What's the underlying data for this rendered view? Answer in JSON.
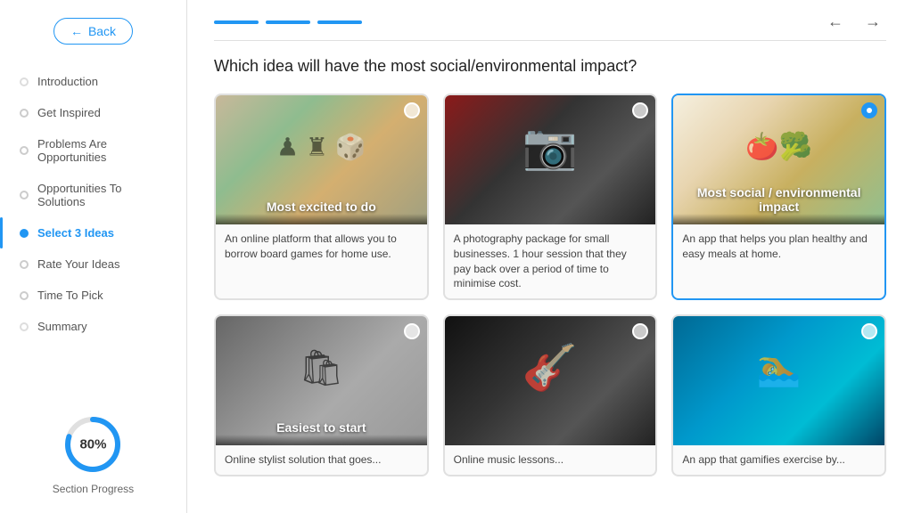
{
  "sidebar": {
    "back_label": "Back",
    "nav_items": [
      {
        "id": "introduction",
        "label": "Introduction",
        "active": false,
        "dot": "dim"
      },
      {
        "id": "get-inspired",
        "label": "Get Inspired",
        "active": false,
        "dot": "normal"
      },
      {
        "id": "problems",
        "label": "Problems Are Opportunities",
        "active": false,
        "dot": "normal"
      },
      {
        "id": "opportunities",
        "label": "Opportunities To Solutions",
        "active": false,
        "dot": "normal"
      },
      {
        "id": "select-ideas",
        "label": "Select 3 Ideas",
        "active": true,
        "dot": "active"
      },
      {
        "id": "rate-ideas",
        "label": "Rate Your Ideas",
        "active": false,
        "dot": "normal"
      },
      {
        "id": "time-to-pick",
        "label": "Time To Pick",
        "active": false,
        "dot": "normal"
      },
      {
        "id": "summary",
        "label": "Summary",
        "active": false,
        "dot": "dim"
      }
    ],
    "progress": {
      "value": 80,
      "label": "Section Progress"
    }
  },
  "header": {
    "steps": [
      {
        "state": "done"
      },
      {
        "state": "done"
      },
      {
        "state": "active"
      }
    ]
  },
  "main": {
    "question": "Which idea will have the most social/environmental impact?",
    "cards": [
      {
        "id": "board-games",
        "img_class": "img-boardgames",
        "tag": "Most excited to do",
        "selected": false,
        "description": "An online platform that allows you to borrow board games for home use."
      },
      {
        "id": "photography",
        "img_class": "img-camera",
        "tag": "",
        "selected": false,
        "description": "A photography package for small businesses. 1 hour session that they pay back over a period of time to minimise cost."
      },
      {
        "id": "cooking",
        "img_class": "img-cooking",
        "tag": "Most social / environmental impact",
        "selected": true,
        "description": "An app that helps you plan healthy and easy meals at home."
      },
      {
        "id": "shop",
        "img_class": "img-shop",
        "tag": "Easiest to start",
        "selected": false,
        "description": "Online stylist solution that goes..."
      },
      {
        "id": "guitar",
        "img_class": "img-guitar",
        "tag": "",
        "selected": false,
        "description": "Online music lessons..."
      },
      {
        "id": "pool",
        "img_class": "img-pool",
        "tag": "",
        "selected": false,
        "description": "An app that gamifies exercise by..."
      }
    ]
  }
}
